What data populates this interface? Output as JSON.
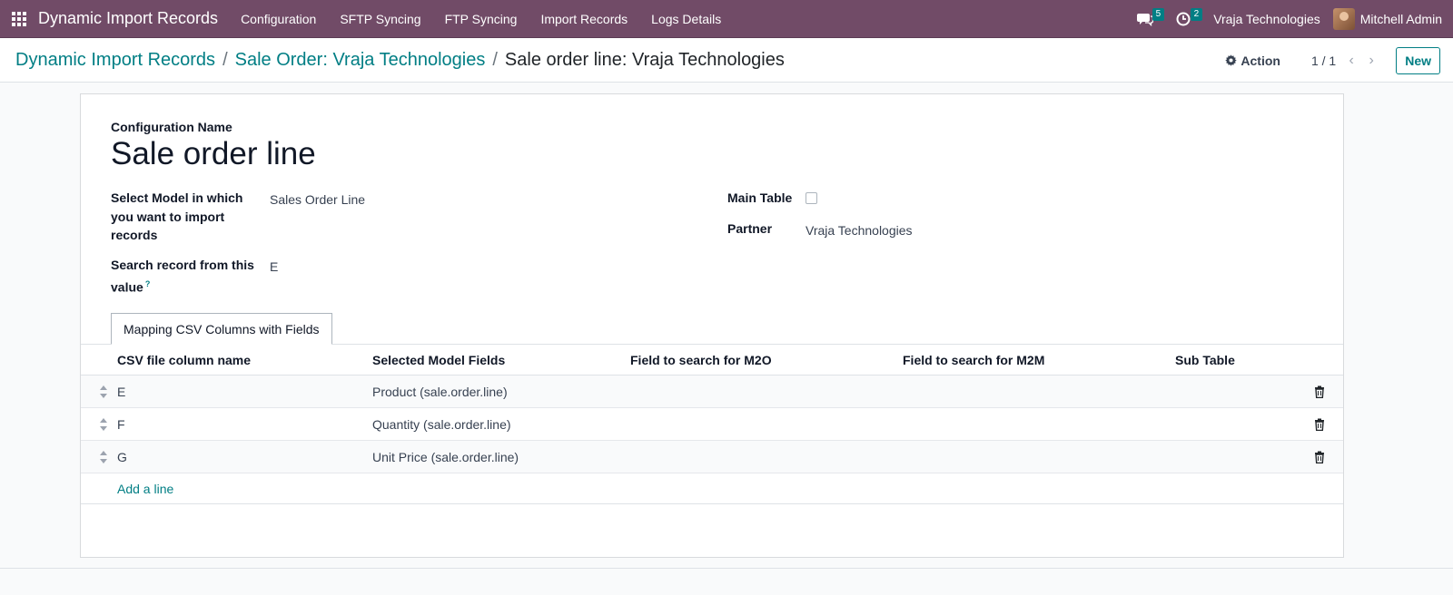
{
  "navbar": {
    "brand": "Dynamic Import Records",
    "menu": [
      "Configuration",
      "SFTP Syncing",
      "FTP Syncing",
      "Import Records",
      "Logs Details"
    ],
    "messages_count": "5",
    "activities_count": "2",
    "company": "Vraja Technologies",
    "user": "Mitchell Admin",
    "accent_color": "#714b67"
  },
  "control_panel": {
    "breadcrumb": [
      "Dynamic Import Records",
      "Sale Order: Vraja Technologies"
    ],
    "breadcrumb_current": "Sale order line: Vraja Technologies",
    "action_label": "Action",
    "pager": "1 / 1",
    "new_label": "New"
  },
  "form": {
    "config_name_label": "Configuration Name",
    "config_name": "Sale order line",
    "model_label": "Select Model in which you want to import records",
    "model_value": "Sales Order Line",
    "search_label": "Search record from this value",
    "search_help": "?",
    "search_value": "E",
    "main_table_label": "Main Table",
    "main_table_checked": false,
    "partner_label": "Partner",
    "partner_value": "Vraja Technologies"
  },
  "tab": {
    "label": "Mapping CSV Columns with Fields"
  },
  "mapping_table": {
    "columns": [
      "CSV file column name",
      "Selected Model Fields",
      "Field to search for M2O",
      "Field to search for M2M",
      "Sub Table"
    ],
    "rows": [
      {
        "csv": "E",
        "field": "Product (sale.order.line)"
      },
      {
        "csv": "F",
        "field": "Quantity (sale.order.line)"
      },
      {
        "csv": "G",
        "field": "Unit Price (sale.order.line)"
      }
    ],
    "add_line": "Add a line"
  }
}
